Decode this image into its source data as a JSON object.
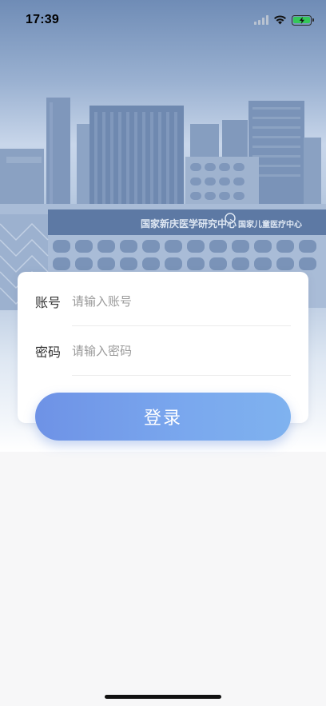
{
  "status_bar": {
    "time": "17:39"
  },
  "hero": {
    "image": "hospital-building-photo",
    "sign_left": "国家新庆医学研究中心",
    "sign_right": "国家儿童医疗中心"
  },
  "login_form": {
    "account": {
      "label": "账号",
      "placeholder": "请输入账号",
      "value": ""
    },
    "password": {
      "label": "密码",
      "placeholder": "请输入密码",
      "value": ""
    },
    "submit_label": "登录"
  },
  "colors": {
    "button_start": "#6e92e6",
    "button_end": "#7fb2ef",
    "battery": "#34c759"
  }
}
